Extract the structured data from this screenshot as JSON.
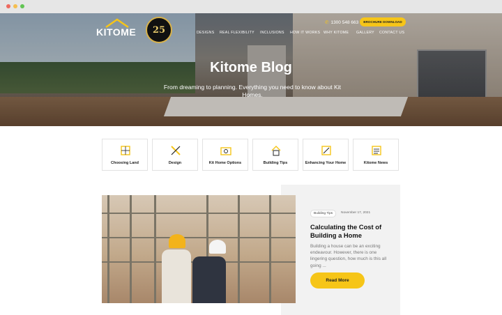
{
  "header": {
    "logo_text": "KITOME",
    "badge_text": "25",
    "nav": [
      "DESIGNS",
      "REAL FLEXIBILITY",
      "INCLUSIONS",
      "HOW IT WORKS",
      "WHY KITOME",
      "GALLERY",
      "CONTACT US"
    ],
    "phone": "1300 548 663",
    "brochure_button": "BROCHURE DOWNLOAD"
  },
  "hero": {
    "title": "Kitome Blog",
    "subtitle": "From dreaming to planning. Everything you need to know about Kit Homes."
  },
  "categories": [
    {
      "label": "Choosing Land",
      "icon": "land-icon"
    },
    {
      "label": "Design",
      "icon": "design-icon"
    },
    {
      "label": "Kit Home Options",
      "icon": "options-icon"
    },
    {
      "label": "Building Tips",
      "icon": "building-tips-icon"
    },
    {
      "label": "Enhancing Your Home",
      "icon": "enhancing-icon"
    },
    {
      "label": "Kitome News",
      "icon": "news-icon"
    }
  ],
  "post": {
    "tag": "Building Tips",
    "date": "November 17, 2021",
    "title": "Calculating the Cost of Building a Home",
    "excerpt": "Building a house can be an exciting endeavour. However, there is one lingering question, how much is this all going ...",
    "button": "Read More"
  },
  "colors": {
    "accent": "#f6c518",
    "card_bg": "#f2f2f2"
  }
}
